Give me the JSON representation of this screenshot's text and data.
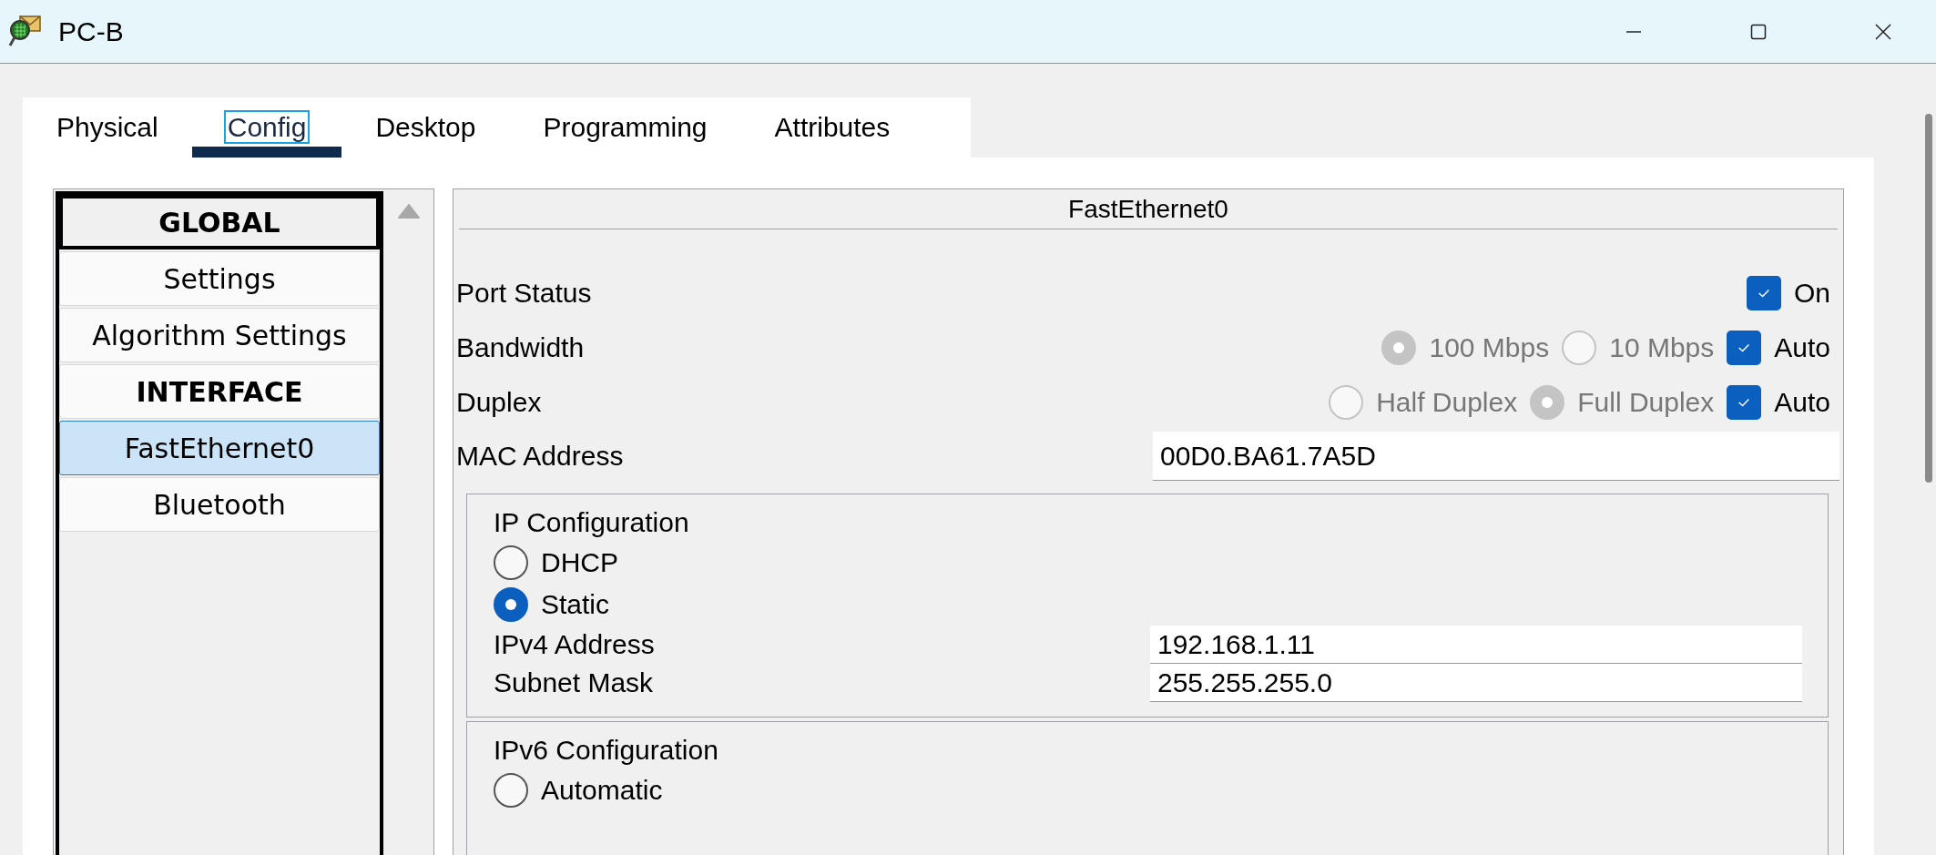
{
  "window": {
    "title": "PC-B"
  },
  "tabs": [
    {
      "label": "Physical",
      "selected": false
    },
    {
      "label": "Config",
      "selected": true
    },
    {
      "label": "Desktop",
      "selected": false
    },
    {
      "label": "Programming",
      "selected": false
    },
    {
      "label": "Attributes",
      "selected": false
    }
  ],
  "sidebar": {
    "items": [
      {
        "label": "GLOBAL",
        "kind": "header",
        "selected": false,
        "focused": true
      },
      {
        "label": "Settings",
        "kind": "item",
        "selected": false,
        "focused": false
      },
      {
        "label": "Algorithm Settings",
        "kind": "item",
        "selected": false,
        "focused": false
      },
      {
        "label": "INTERFACE",
        "kind": "header",
        "selected": false,
        "focused": false
      },
      {
        "label": "FastEthernet0",
        "kind": "item",
        "selected": true,
        "focused": false
      },
      {
        "label": "Bluetooth",
        "kind": "item",
        "selected": false,
        "focused": false
      }
    ]
  },
  "interface": {
    "title": "FastEthernet0",
    "port_status": {
      "label": "Port Status",
      "checkbox": {
        "label": "On",
        "checked": true
      }
    },
    "bandwidth": {
      "label": "Bandwidth",
      "disabled": true,
      "options": [
        {
          "label": "100 Mbps",
          "selected": true
        },
        {
          "label": "10 Mbps",
          "selected": false
        }
      ],
      "auto": {
        "label": "Auto",
        "checked": true
      }
    },
    "duplex": {
      "label": "Duplex",
      "disabled": true,
      "options": [
        {
          "label": "Half Duplex",
          "selected": false
        },
        {
          "label": "Full Duplex",
          "selected": true
        }
      ],
      "auto": {
        "label": "Auto",
        "checked": true
      }
    },
    "mac": {
      "label": "MAC Address",
      "value": "00D0.BA61.7A5D"
    },
    "ip_config": {
      "title": "IP Configuration",
      "modes": [
        {
          "label": "DHCP",
          "selected": false
        },
        {
          "label": "Static",
          "selected": true
        }
      ],
      "fields": [
        {
          "label": "IPv4 Address",
          "value": "192.168.1.11"
        },
        {
          "label": "Subnet Mask",
          "value": "255.255.255.0"
        }
      ]
    },
    "ipv6_config": {
      "title": "IPv6 Configuration",
      "modes": [
        {
          "label": "Automatic",
          "selected": false
        }
      ]
    }
  }
}
